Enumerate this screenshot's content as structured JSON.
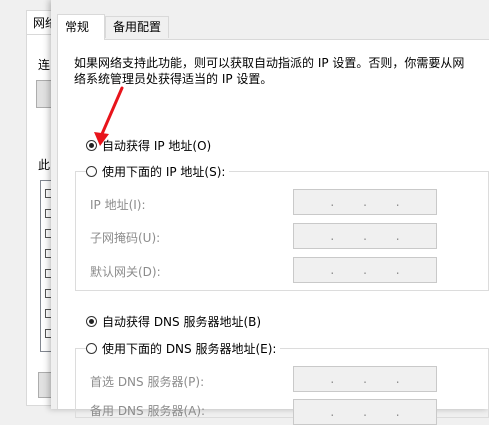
{
  "background_dialog": {
    "tab_label": "网络",
    "connect_label": "连",
    "items_label": "此"
  },
  "tabs": [
    {
      "label": "常规"
    },
    {
      "label": "备用配置"
    }
  ],
  "description": "如果网络支持此功能，则可以获取自动指派的 IP 设置。否则，你需要从网络系统管理员处获得适当的 IP 设置。",
  "ip_section": {
    "auto_option": "自动获得 IP 地址(O)",
    "manual_option": "使用下面的 IP 地址(S):",
    "auto_selected": true,
    "fields": [
      {
        "label": "IP 地址(I):",
        "value": ". . ."
      },
      {
        "label": "子网掩码(U):",
        "value": ". . ."
      },
      {
        "label": "默认网关(D):",
        "value": ". . ."
      }
    ]
  },
  "dns_section": {
    "auto_option": "自动获得 DNS 服务器地址(B)",
    "manual_option": "使用下面的 DNS 服务器地址(E):",
    "auto_selected": true,
    "fields": [
      {
        "label": "首选 DNS 服务器(P):",
        "value": ". . ."
      },
      {
        "label": "备用 DNS 服务器(A):",
        "value": ". . ."
      }
    ]
  },
  "colors": {
    "annotation_arrow": "#e8141b",
    "disabled_text": "#8c8c8c"
  }
}
